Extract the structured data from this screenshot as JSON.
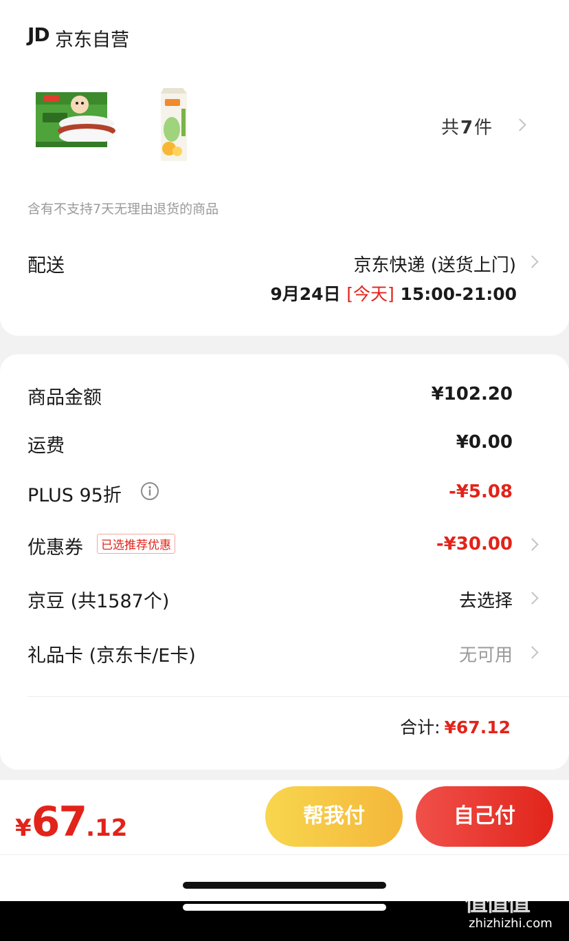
{
  "shop": {
    "logo": "JD",
    "name": "京东自营"
  },
  "products": {
    "images": [
      "rice-burger-package",
      "juice-carton"
    ],
    "count_prefix": "共",
    "count": "7",
    "count_suffix": "件"
  },
  "return_notice": "含有不支持7天无理由退货的商品",
  "delivery": {
    "label": "配送",
    "method": "京东快递 (送货上门)",
    "date": "9月24日",
    "today_tag": "[今天]",
    "time_window": "15:00-21:00"
  },
  "summary": {
    "goods_amount": {
      "label": "商品金额",
      "value": "¥102.20"
    },
    "shipping": {
      "label": "运费",
      "value": "¥0.00"
    },
    "plus": {
      "label": "PLUS 95折",
      "value": "-¥5.08"
    },
    "coupon": {
      "label": "优惠券",
      "badge": "已选推荐优惠",
      "value": "-¥30.00"
    },
    "jingdou": {
      "label": "京豆 (共1587个)",
      "value": "去选择"
    },
    "gift_card": {
      "label": "礼品卡 (京东卡/E卡)",
      "value": "无可用"
    },
    "total_label": "合计:",
    "total_value": "¥67.12"
  },
  "footer": {
    "currency": "¥",
    "amount_int": "67",
    "amount_dec": ".12",
    "help_pay": "帮我付",
    "self_pay": "自己付"
  },
  "watermark": {
    "text": "zhizhizhi.com",
    "logo_glyph": "值值值"
  },
  "colors": {
    "accent_red": "#e2231a",
    "help_pay_start": "#f8d64e",
    "help_pay_end": "#f4b73a",
    "self_pay_start": "#f0504a",
    "self_pay_end": "#e1251b"
  }
}
